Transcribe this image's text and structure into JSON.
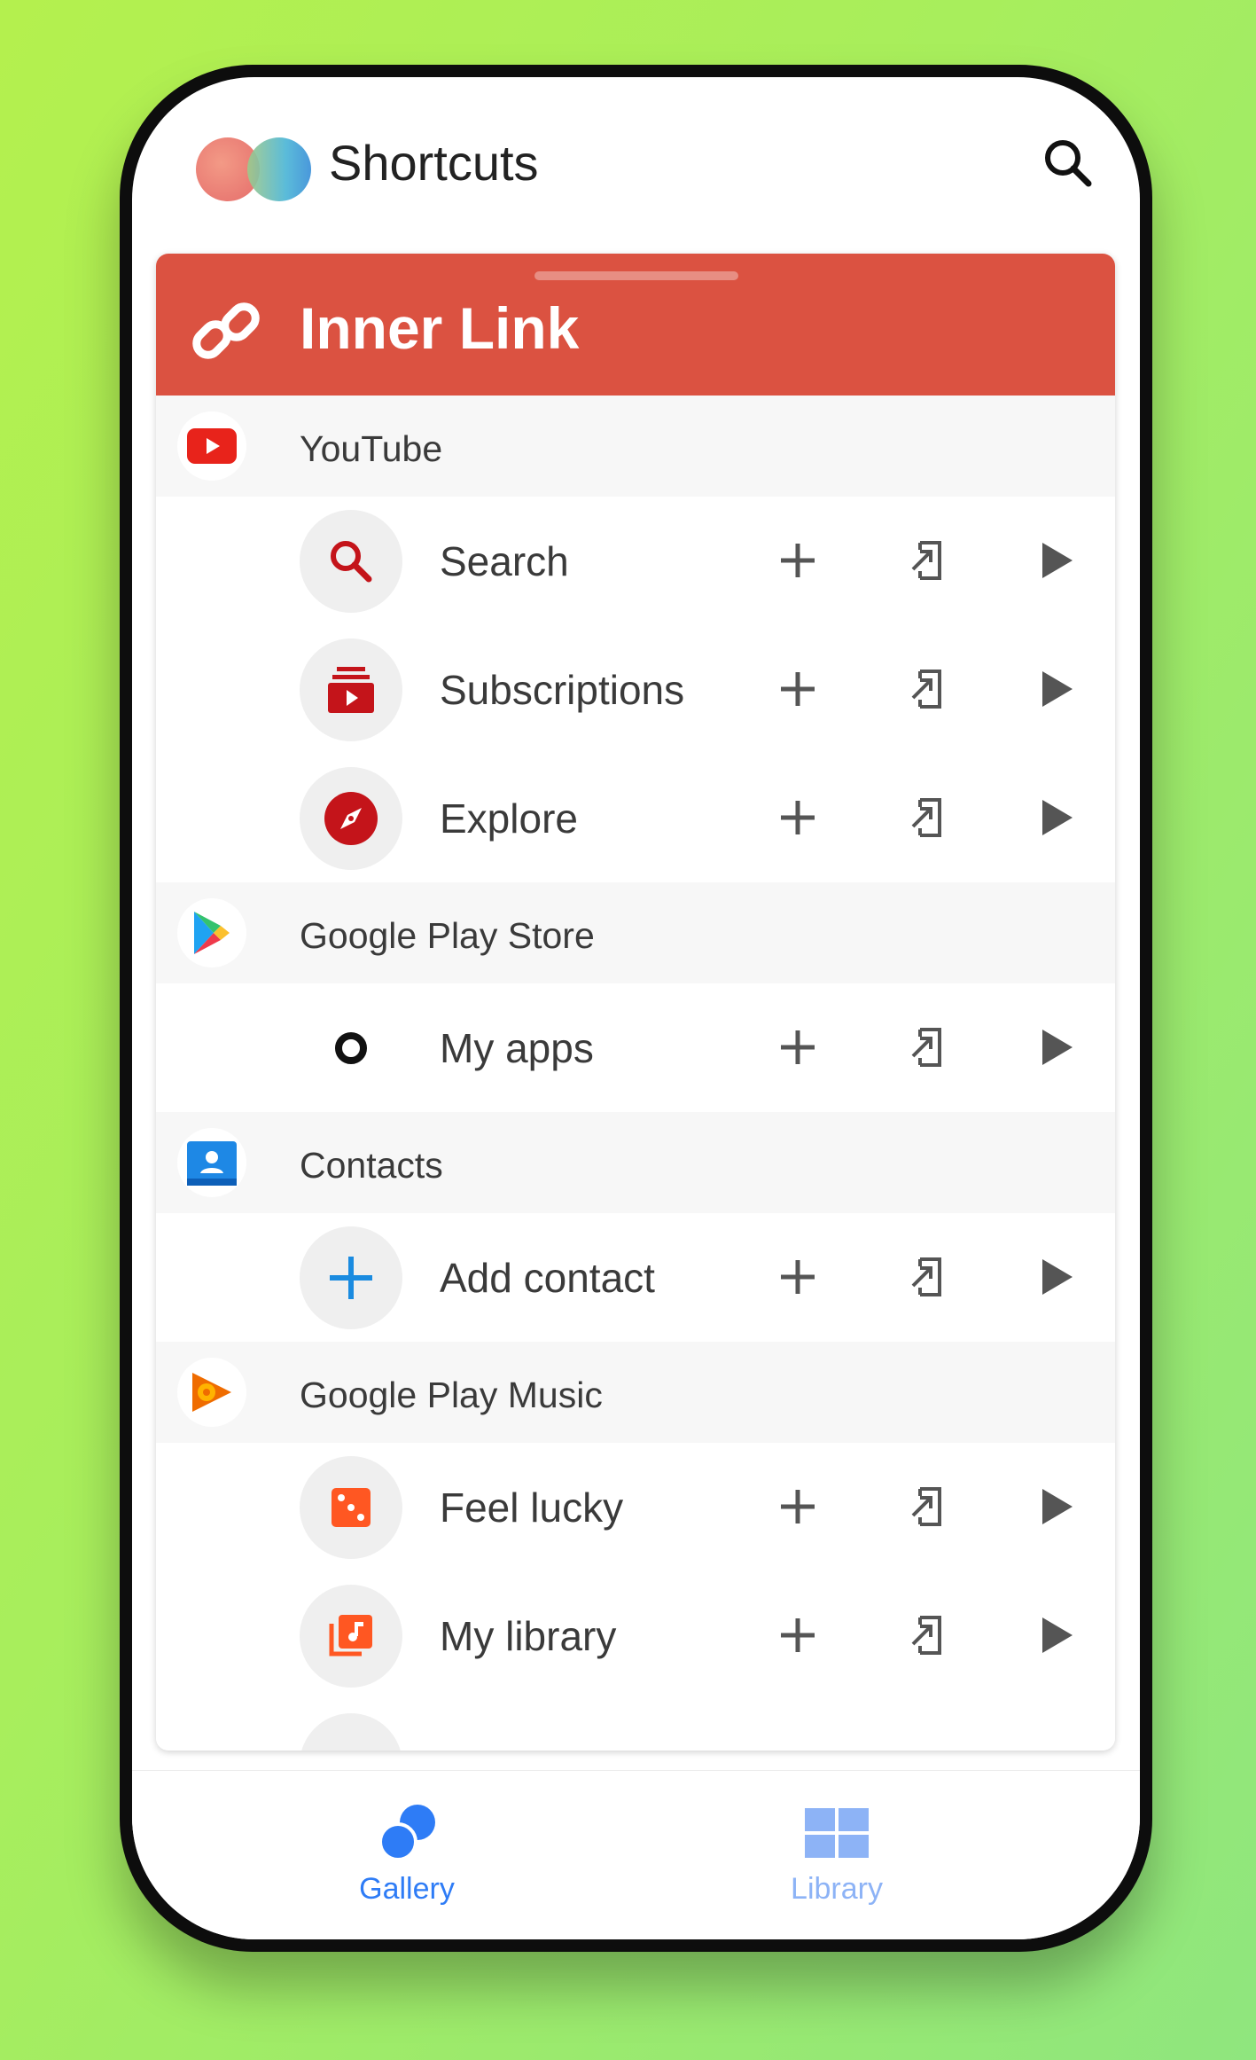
{
  "app": {
    "title": "Shortcuts"
  },
  "card": {
    "title": "Inner Link",
    "header_color": "#db5241"
  },
  "groups": [
    {
      "label": "YouTube",
      "icon": "youtube-icon",
      "items": [
        {
          "label": "Search",
          "icon": "search-icon"
        },
        {
          "label": "Subscriptions",
          "icon": "subscriptions-icon"
        },
        {
          "label": "Explore",
          "icon": "compass-icon"
        }
      ]
    },
    {
      "label": "Google Play Store",
      "icon": "play-store-icon",
      "items": [
        {
          "label": "My apps",
          "icon": "ring-icon"
        }
      ]
    },
    {
      "label": "Contacts",
      "icon": "contacts-icon",
      "items": [
        {
          "label": "Add contact",
          "icon": "plus-icon"
        }
      ]
    },
    {
      "label": "Google Play Music",
      "icon": "play-music-icon",
      "items": [
        {
          "label": "Feel lucky",
          "icon": "dice-icon"
        },
        {
          "label": "My library",
          "icon": "music-library-icon"
        }
      ]
    }
  ],
  "actions": {
    "add": "plus-icon",
    "open": "open-external-icon",
    "run": "play-icon"
  },
  "nav": {
    "gallery": {
      "label": "Gallery",
      "icon": "gallery-icon",
      "active": true
    },
    "library": {
      "label": "Library",
      "icon": "grid-icon",
      "active": false
    }
  },
  "colors": {
    "accent": "#2e7cf6",
    "youtube_red": "#d71a17",
    "play_music_orange": "#ff5722"
  }
}
